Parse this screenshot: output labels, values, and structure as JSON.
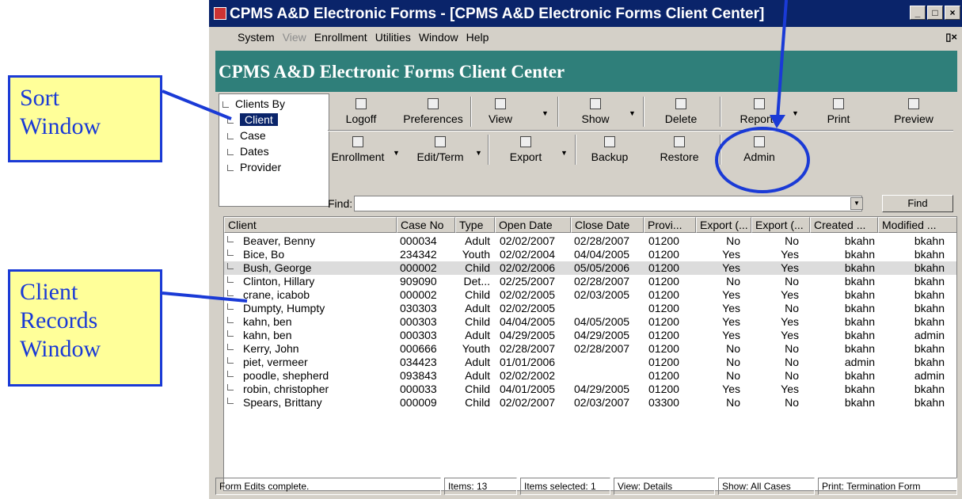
{
  "callouts": {
    "sort": "Sort\nWindow",
    "sort_l1": "Sort",
    "sort_l2": "Window",
    "client_l1": "Client",
    "client_l2": "Records",
    "client_l3": "Window"
  },
  "window": {
    "title": "CPMS A&D Electronic Forms - [CPMS A&D  Electronic Forms Client Center]",
    "min": "_",
    "max": "□",
    "close": "×",
    "restore": "▯×"
  },
  "menu": {
    "items": [
      {
        "label": "System",
        "enabled": true
      },
      {
        "label": "View",
        "enabled": false
      },
      {
        "label": "Enrollment",
        "enabled": true
      },
      {
        "label": "Utilities",
        "enabled": true
      },
      {
        "label": "Window",
        "enabled": true
      },
      {
        "label": "Help",
        "enabled": true
      }
    ]
  },
  "header": {
    "title": "CPMS A&D Electronic Forms Client Center"
  },
  "sort": {
    "root": "Clients By",
    "items": [
      "Client",
      "Case",
      "Dates",
      "Provider"
    ],
    "selected": "Client"
  },
  "toolbar": {
    "row1": [
      "Logoff",
      "Preferences",
      "View",
      "Show",
      "Delete",
      "Reports",
      "Print",
      "Preview"
    ],
    "row2": [
      "Enrollment",
      "Edit/Term",
      "Export",
      "Backup",
      "Restore",
      "Admin"
    ]
  },
  "find": {
    "label": "Find:",
    "button": "Find",
    "value": ""
  },
  "grid": {
    "columns": [
      "Client",
      "Case No",
      "Type",
      "Open Date",
      "Close Date",
      "Provi...",
      "Export (...",
      "Export (...",
      "Created ...",
      "Modified ..."
    ],
    "rows": [
      [
        "Beaver, Benny",
        "000034",
        "Adult",
        "02/02/2007",
        "02/28/2007",
        "01200",
        "No",
        "No",
        "bkahn",
        "bkahn"
      ],
      [
        "Bice, Bo",
        "234342",
        "Youth",
        "02/02/2004",
        "04/04/2005",
        "01200",
        "Yes",
        "Yes",
        "bkahn",
        "bkahn"
      ],
      [
        "Bush, George",
        "000002",
        "Child",
        "02/02/2006",
        "05/05/2006",
        "01200",
        "Yes",
        "Yes",
        "bkahn",
        "bkahn"
      ],
      [
        "Clinton, Hillary",
        "909090",
        "Det...",
        "02/25/2007",
        "02/28/2007",
        "01200",
        "No",
        "No",
        "bkahn",
        "bkahn"
      ],
      [
        "crane, icabob",
        "000002",
        "Child",
        "02/02/2005",
        "02/03/2005",
        "01200",
        "Yes",
        "Yes",
        "bkahn",
        "bkahn"
      ],
      [
        "Dumpty, Humpty",
        "030303",
        "Adult",
        "02/02/2005",
        "",
        "01200",
        "Yes",
        "No",
        "bkahn",
        "bkahn"
      ],
      [
        "kahn, ben",
        "000303",
        "Child",
        "04/04/2005",
        "04/05/2005",
        "01200",
        "Yes",
        "Yes",
        "bkahn",
        "bkahn"
      ],
      [
        "kahn, ben",
        "000303",
        "Adult",
        "04/29/2005",
        "04/29/2005",
        "01200",
        "Yes",
        "Yes",
        "bkahn",
        "admin"
      ],
      [
        "Kerry, John",
        "000666",
        "Youth",
        "02/28/2007",
        "02/28/2007",
        "01200",
        "No",
        "No",
        "bkahn",
        "bkahn"
      ],
      [
        "piet, vermeer",
        "034423",
        "Adult",
        "01/01/2006",
        "",
        "01200",
        "No",
        "No",
        "admin",
        "bkahn"
      ],
      [
        "poodle, shepherd",
        "093843",
        "Adult",
        "02/02/2002",
        "",
        "01200",
        "No",
        "No",
        "bkahn",
        "admin"
      ],
      [
        "robin, christopher",
        "000033",
        "Child",
        "04/01/2005",
        "04/29/2005",
        "01200",
        "Yes",
        "Yes",
        "bkahn",
        "bkahn"
      ],
      [
        "Spears, Brittany",
        "000009",
        "Child",
        "02/02/2007",
        "02/03/2007",
        "03300",
        "No",
        "No",
        "bkahn",
        "bkahn"
      ]
    ],
    "selected_row": 2
  },
  "status": [
    "Form Edits complete.",
    "Items: 13",
    "Items selected: 1",
    "View: Details",
    "Show: All Cases",
    "Print: Termination Form"
  ],
  "colors": {
    "callout_border": "#1a3ad6",
    "callout_fill": "#ffff99",
    "title_bg": "#0a246a",
    "header_bg": "#2f7f7a"
  }
}
